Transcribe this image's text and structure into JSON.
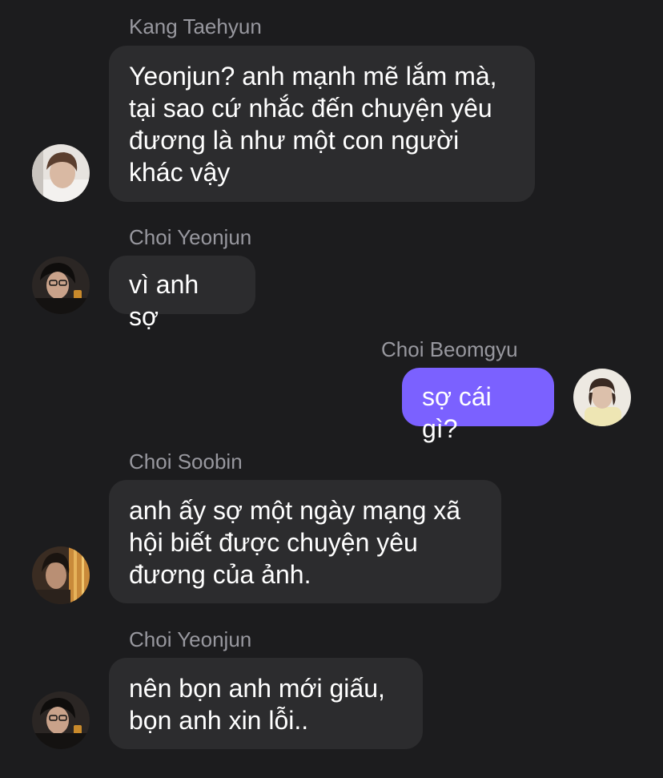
{
  "messages": [
    {
      "sender": "Kang Taehyun",
      "text": "Yeonjun? anh mạnh mẽ lắm mà,\ntại sao cứ nhắc đến chuyện yêu\nđương là như một con người\nkhác vậy",
      "avatar_icon": "avatar-kang-taehyun-icon"
    },
    {
      "sender": "Choi Yeonjun",
      "text": "vì anh sợ",
      "avatar_icon": "avatar-choi-yeonjun-icon"
    },
    {
      "sender": "Choi Beomgyu",
      "text": "sợ cái gì?",
      "avatar_icon": "avatar-choi-beomgyu-icon",
      "outgoing": true
    },
    {
      "sender": "Choi Soobin",
      "text": "anh ấy sợ một ngày mạng xã\nhội biết được chuyện yêu\nđương của ảnh.",
      "avatar_icon": "avatar-choi-soobin-icon"
    },
    {
      "sender": "Choi Yeonjun",
      "text": "nên bọn anh mới giấu,\nbọn anh xin lỗi..",
      "avatar_icon": "avatar-choi-yeonjun-icon"
    }
  ],
  "colors": {
    "background": "#1c1c1e",
    "incoming_bubble": "#2c2c2e",
    "outgoing_bubble": "#7b61ff",
    "sender_name": "#98989f"
  }
}
